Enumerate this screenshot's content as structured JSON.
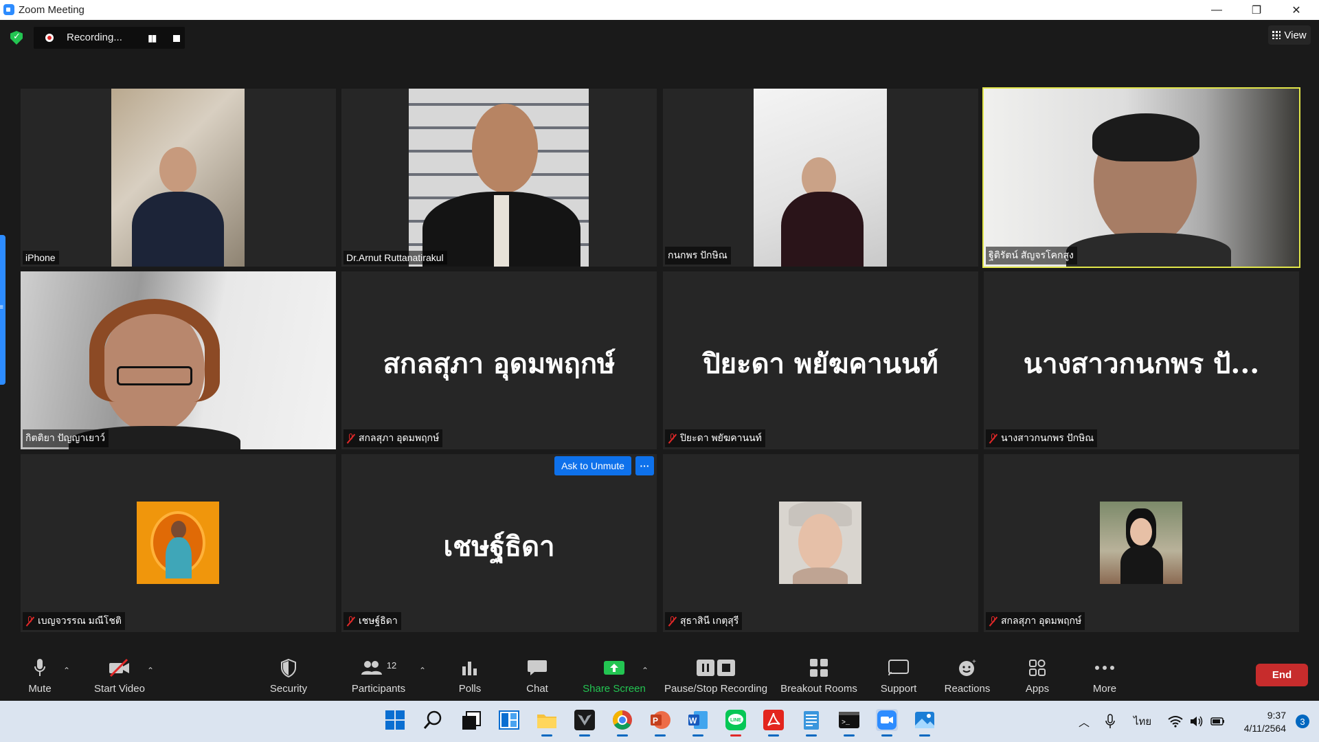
{
  "window": {
    "title": "Zoom Meeting"
  },
  "top": {
    "recording_label": "Recording...",
    "view_label": "View"
  },
  "tiles": [
    {
      "name": "iPhone",
      "video": true,
      "muted": false
    },
    {
      "name": "Dr.Arnut Ruttanatirakul",
      "video": true,
      "muted": false
    },
    {
      "name": "กนกพร ปักษิณ",
      "video": true,
      "muted": false
    },
    {
      "name": "ฐิติรัตน์ สัญจรโคกสูง",
      "video": true,
      "muted": false,
      "active_speaker": true
    },
    {
      "name": "กิตติยา ปัญญาเยาว์",
      "video": true,
      "muted": false
    },
    {
      "name": "สกลสุภา อุดมพฤกษ์",
      "display": "สกลสุภา อุดมพฤกษ์",
      "video": false,
      "muted": true
    },
    {
      "name": "ปิยะดา พยัฆคานนท์",
      "display": "ปิยะดา พยัฆคานนท์",
      "video": false,
      "muted": true
    },
    {
      "name": "นางสาวกนกพร ปักษิณ",
      "display": "นางสาวกนกพร ปั...",
      "video": false,
      "muted": true
    },
    {
      "name": "เบญจวรรณ มณีโชติ",
      "video": false,
      "muted": true,
      "avatar": true
    },
    {
      "name": "เชษฐ์ธิดา",
      "display": "เชษฐ์ธิดา",
      "video": false,
      "muted": true
    },
    {
      "name": "สุธาสินี เกตุสุรี",
      "video": false,
      "muted": true,
      "avatar": true
    },
    {
      "name": "สกลสุภา อุดมพฤกษ์",
      "video": false,
      "muted": true,
      "avatar": true
    }
  ],
  "hover_actions": {
    "ask_to_unmute": "Ask to Unmute",
    "more": "···"
  },
  "toolbar": {
    "mute": "Mute",
    "start_video": "Start Video",
    "security": "Security",
    "participants": "Participants",
    "participants_count": "12",
    "polls": "Polls",
    "chat": "Chat",
    "share_screen": "Share Screen",
    "pause_stop_recording": "Pause/Stop Recording",
    "breakout_rooms": "Breakout Rooms",
    "support": "Support",
    "reactions": "Reactions",
    "apps": "Apps",
    "more": "More",
    "end": "End"
  },
  "taskbar": {
    "language": "ไทย",
    "time": "9:37",
    "date": "4/11/2564",
    "notifications": "3"
  },
  "colors": {
    "accent": "#2d8cff",
    "active_speaker": "#e2e64a",
    "end_button": "#c72c2c",
    "share_green": "#23c552",
    "muted_red": "#e02828"
  }
}
